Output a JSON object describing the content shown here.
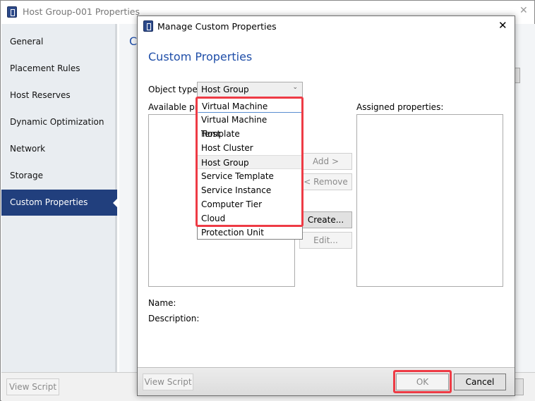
{
  "background_window": {
    "title": "Host Group-001 Properties",
    "close": "✕",
    "content_heading_partial": "C",
    "nav": [
      {
        "label": "General"
      },
      {
        "label": "Placement Rules"
      },
      {
        "label": "Host Reserves"
      },
      {
        "label": "Dynamic Optimization"
      },
      {
        "label": "Network"
      },
      {
        "label": "Storage"
      },
      {
        "label": "Custom Properties",
        "selected": true
      }
    ],
    "view_script": "View Script"
  },
  "dialog": {
    "title": "Manage Custom Properties",
    "close": "✕",
    "heading": "Custom Properties",
    "object_type_label": "Object type:",
    "object_type_value": "Host Group",
    "available_label": "Available pro",
    "assigned_label": "Assigned properties:",
    "dropdown_options": [
      "Virtual Machine",
      "Virtual Machine Template",
      "Host",
      "Host Cluster",
      "Host Group",
      "Service Template",
      "Service Instance",
      "Computer Tier",
      "Cloud",
      "Protection Unit"
    ],
    "hover_option": "Host Group",
    "buttons": {
      "add": "Add >",
      "remove": "< Remove",
      "create": "Create...",
      "edit": "Edit...",
      "view_script": "View Script",
      "ok": "OK",
      "cancel": "Cancel"
    },
    "name_label": "Name:",
    "description_label": "Description:"
  },
  "colors": {
    "accent": "#213f7d",
    "heading": "#1f4ea8",
    "highlight": "#ee3b45"
  }
}
